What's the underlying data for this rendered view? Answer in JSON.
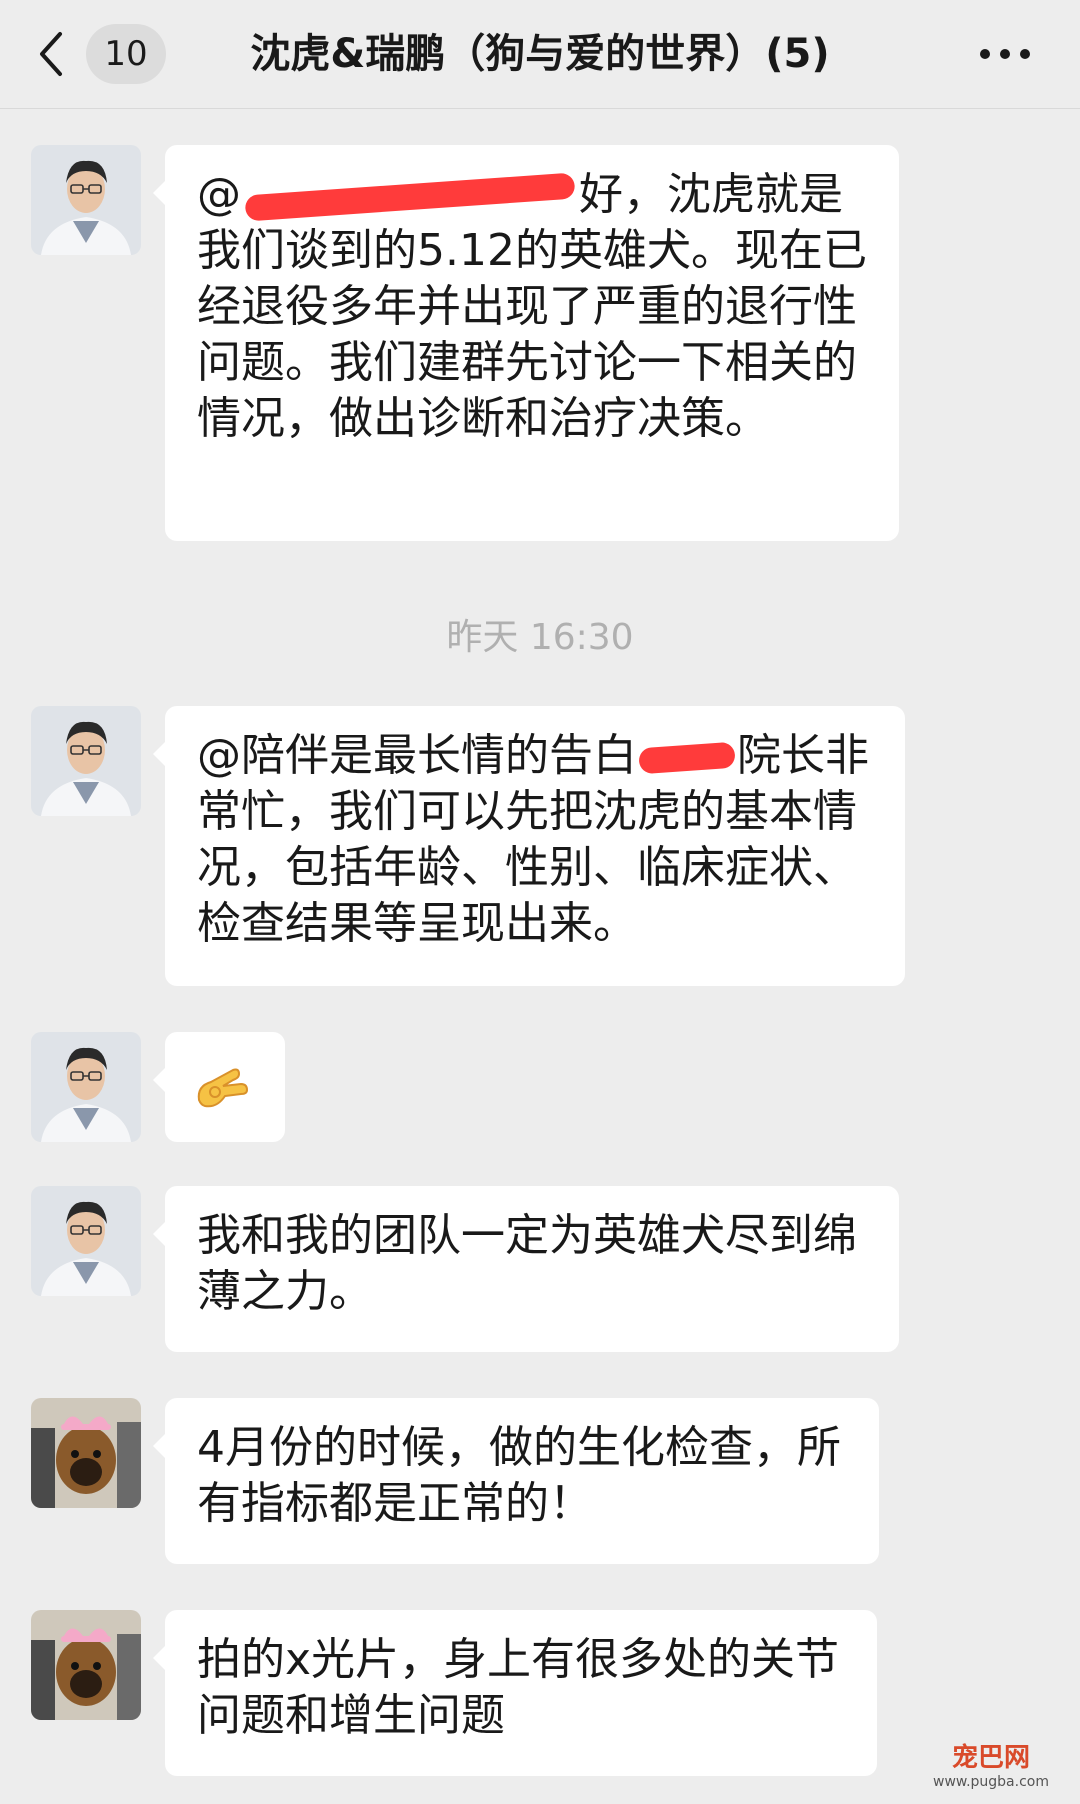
{
  "header": {
    "back_icon": "chevron-left-icon",
    "unread_count": "10",
    "title": "沈虎&瑞鹏（狗与爱的世界）(5)",
    "more_icon": "more-dots-icon"
  },
  "timestamp": "昨天 16:30",
  "messages": [
    {
      "avatar": "doctor-avatar",
      "text_prefix": "@",
      "text_suffix": "好，沈虎就是我们谈到的5.12的英雄犬。现在已经退役多年并出现了严重的退行性问题。我们建群先讨论一下相关的情况，做出诊断和治疗决策。"
    },
    {
      "avatar": "doctor-avatar",
      "text_prefix": "@陪伴是最长情的告白",
      "text_suffix": "院长非常忙，我们可以先把沈虎的基本情况，包括年龄、性别、临床症状、检查结果等呈现出来。"
    },
    {
      "avatar": "doctor-avatar",
      "emoji": "👌"
    },
    {
      "avatar": "doctor-avatar",
      "text": "我和我的团队一定为英雄犬尽到绵薄之力。"
    },
    {
      "avatar": "dog-avatar",
      "text": "4月份的时候，做的生化检查，所有指标都是正常的！"
    },
    {
      "avatar": "dog-avatar",
      "text": "拍的x光片，身上有很多处的关节问题和增生问题"
    }
  ],
  "watermark": {
    "name": "宠巴网",
    "url": "www.pugba.com"
  },
  "colors": {
    "background": "#ededed",
    "bubble": "#ffffff",
    "redaction": "#ff2a2a"
  }
}
